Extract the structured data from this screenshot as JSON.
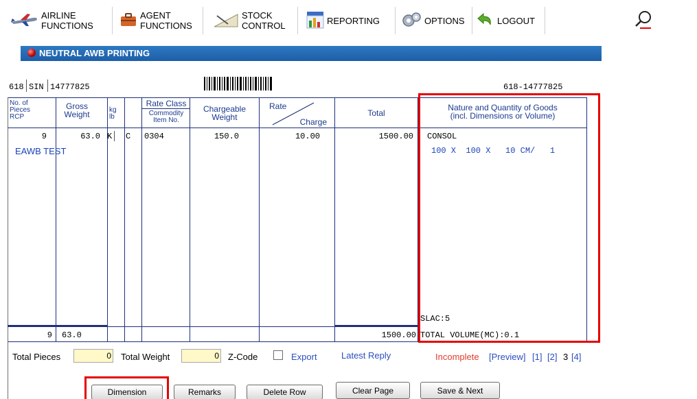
{
  "nav": {
    "items": [
      {
        "line1": "AIRLINE",
        "line2": "FUNCTIONS"
      },
      {
        "line1": "AGENT",
        "line2": "FUNCTIONS"
      },
      {
        "line1": "STOCK",
        "line2": "CONTROL"
      },
      {
        "line1": "REPORTING"
      },
      {
        "line1": "OPTIONS"
      },
      {
        "line1": "LOGOUT"
      }
    ]
  },
  "section": {
    "title": "NEUTRAL AWB PRINTING"
  },
  "awb": {
    "prefix": "618",
    "origin": "SIN",
    "serial": "14777825",
    "full_number": "618-14777825"
  },
  "table": {
    "headers": {
      "pieces": [
        "No. of",
        "Pieces",
        "RCP"
      ],
      "gross": [
        "Gross",
        "Weight"
      ],
      "kglb": [
        "kg",
        "lb"
      ],
      "rate_class": "Rate Class",
      "commodity": [
        "Commodity",
        "Item No."
      ],
      "chargeable": [
        "Chargeable",
        "Weight"
      ],
      "rate": "Rate",
      "charge": "Charge",
      "total": "Total",
      "goods": [
        "Nature and Quantity of Goods",
        "(incl. Dimensions or Volume)"
      ]
    },
    "row": {
      "pieces": "9",
      "gross": "63.0",
      "kglb": "K",
      "rate_class": "C",
      "commodity": "0304",
      "chargeable": "150.0",
      "rate": "10.00",
      "total": "1500.00",
      "goods": "CONSOL"
    },
    "description": "EAWB TEST",
    "dimension_line": "100 X  100 X   10 CM/   1",
    "slac": "SLAC:5",
    "totals": {
      "pieces": "9",
      "gross": "63.0",
      "total": "1500.00",
      "volume": "TOTAL VOLUME(MC):0.1"
    }
  },
  "footer": {
    "total_pieces_label": "Total Pieces",
    "total_pieces_value": "0",
    "total_weight_label": "Total Weight",
    "total_weight_value": "0",
    "zcode_label": "Z-Code",
    "export_label": "Export",
    "latest_reply": "Latest Reply",
    "status": "Incomplete",
    "preview": "[Preview]",
    "page1": "[1]",
    "page2": "[2]",
    "page3": "3",
    "page4": "[4]"
  },
  "buttons": {
    "dimension": "Dimension",
    "remarks": "Remarks",
    "delete_row": "Delete Row",
    "clear_page": "Clear Page",
    "save_next": "Save & Next"
  },
  "colors": {
    "section_bar": "#1d5ea8",
    "table_lines": "#1f2f7a",
    "highlight": "#e60000",
    "input_bg": "#fff8c8",
    "link": "#2a4fc0",
    "status_red": "#e33b2d"
  }
}
